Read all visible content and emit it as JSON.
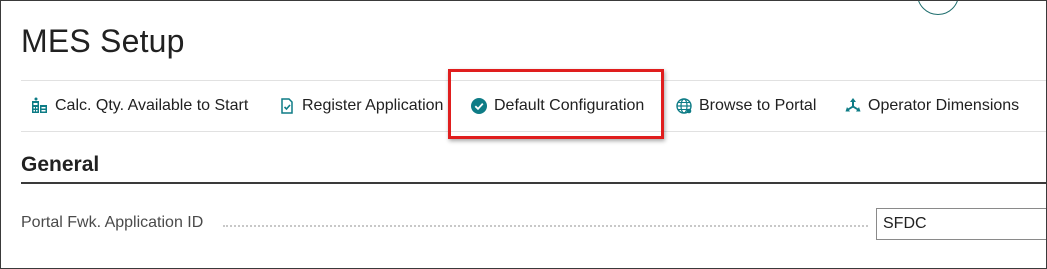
{
  "page": {
    "title": "MES Setup"
  },
  "actions": [
    {
      "label": "Calc. Qty. Available to Start",
      "icon": "calculate-icon"
    },
    {
      "label": "Register Application",
      "icon": "register-document-icon"
    },
    {
      "label": "Default Configuration",
      "icon": "check-circle-icon"
    },
    {
      "label": "Browse to Portal",
      "icon": "globe-icon"
    },
    {
      "label": "Operator Dimensions",
      "icon": "dimensions-icon"
    }
  ],
  "section": {
    "title": "General"
  },
  "fields": {
    "portal_app_id": {
      "label": "Portal Fwk. Application ID",
      "value": "SFDC"
    }
  },
  "colors": {
    "accent": "#0e7c86",
    "highlight": "#e01e1e",
    "text": "#212121"
  }
}
